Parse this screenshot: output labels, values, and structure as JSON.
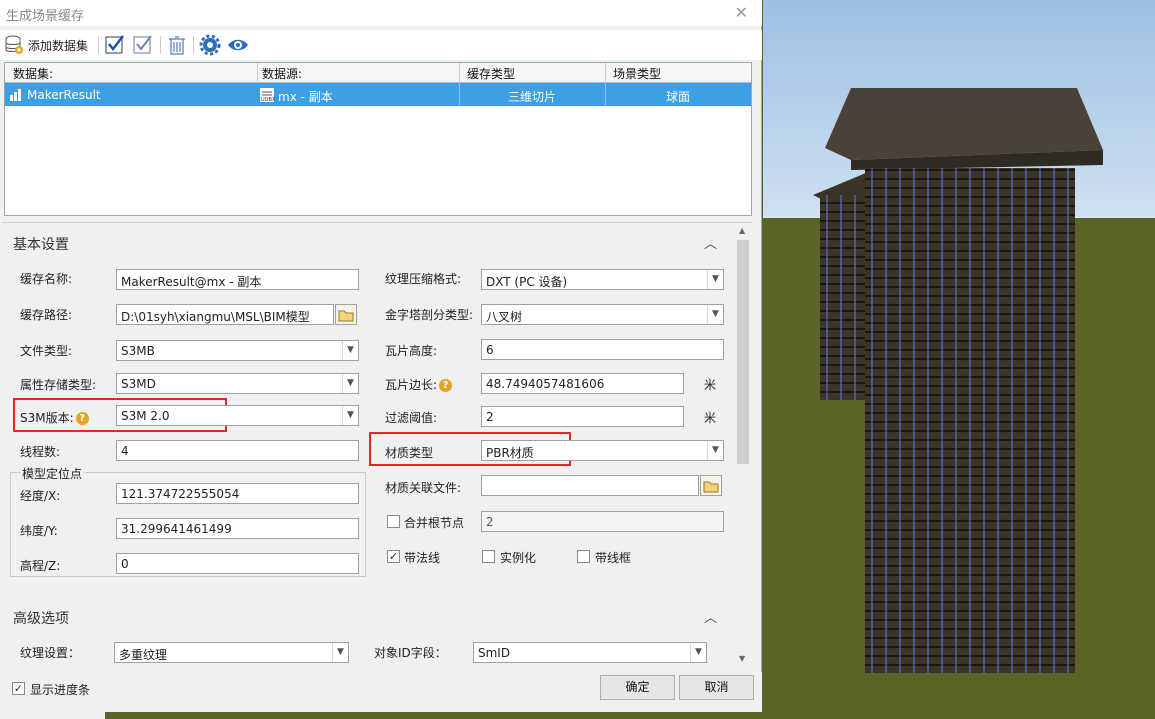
{
  "dialog": {
    "title": "生成场景缓存"
  },
  "toolbar": {
    "add_dataset": "添加数据集"
  },
  "grid": {
    "columns": [
      "数据集:",
      "数据源:",
      "缓存类型",
      "场景类型"
    ],
    "rows": [
      {
        "dataset": "MakerResult",
        "datasource": "mx - 副本",
        "cache_type": "三维切片",
        "scene_type": "球面"
      }
    ]
  },
  "basic": {
    "title": "基本设置",
    "cache_name_label": "缓存名称:",
    "cache_name": "MakerResult@mx - 副本",
    "cache_path_label": "缓存路径:",
    "cache_path": "D:\\01syh\\xiangmu\\MSL\\BIM模型",
    "file_type_label": "文件类型:",
    "file_type": "S3MB",
    "attr_storage_label": "属性存储类型:",
    "attr_storage": "S3MD",
    "s3m_version_label": "S3M版本:",
    "s3m_version": "S3M 2.0",
    "threads_label": "线程数:",
    "threads": "4",
    "model_pos_title": "模型定位点",
    "lon_label": "经度/X:",
    "lon": "121.374722555054",
    "lat_label": "纬度/Y:",
    "lat": "31.299641461499",
    "alt_label": "高程/Z:",
    "alt": "0",
    "tex_compress_label": "纹理压缩格式:",
    "tex_compress": "DXT (PC 设备)",
    "pyramid_label": "金字塔剖分类型:",
    "pyramid": "八叉树",
    "tile_height_label": "瓦片高度:",
    "tile_height": "6",
    "tile_edge_label": "瓦片边长:",
    "tile_edge": "48.7494057481606",
    "tile_edge_unit": "米",
    "filter_label": "过滤阈值:",
    "filter": "2",
    "filter_unit": "米",
    "material_type_label": "材质类型",
    "material_type": "PBR材质",
    "material_file_label": "材质关联文件:",
    "material_file": "",
    "merge_root_label": "合并根节点",
    "merge_root": "2",
    "with_normals_label": "带法线",
    "instancing_label": "实例化",
    "wireframe_label": "带线框"
  },
  "advanced": {
    "title": "高级选项",
    "texture_label": "纹理设置：",
    "texture": "多重纹理",
    "object_id_label": "对象ID字段：",
    "object_id": "SmID"
  },
  "footer": {
    "show_progress": "显示进度条",
    "ok": "确定",
    "cancel": "取消"
  },
  "colors": {
    "selection": "#3da0e6",
    "highlight_box": "#e8262a",
    "help_icon": "#e6a320"
  }
}
